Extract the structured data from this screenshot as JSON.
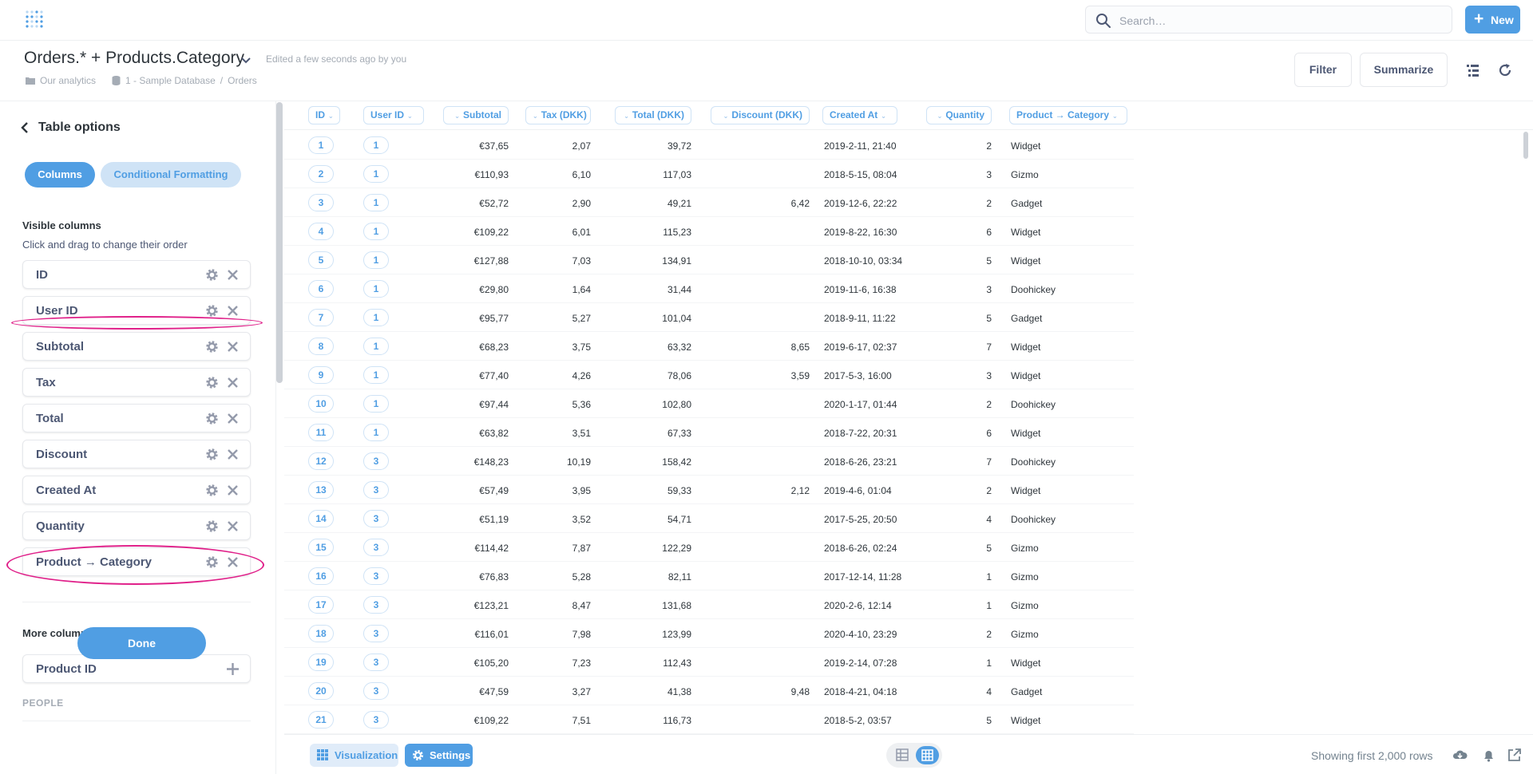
{
  "app": {
    "search_placeholder": "Search…",
    "new_label": "New",
    "accent": "#509ee3",
    "highlight": "#e0218a"
  },
  "question": {
    "title": "Orders.* + Products.Category",
    "edited": "Edited a few seconds ago by you",
    "breadcrumb": [
      "Our analytics",
      "1 - Sample Database",
      "Orders"
    ],
    "filter_label": "Filter",
    "summarize_label": "Summarize"
  },
  "sidebar": {
    "back_label": "Table options",
    "tabs": [
      "Columns",
      "Conditional Formatting"
    ],
    "visible_title": "Visible columns",
    "visible_hint": "Click and drag to change their order",
    "visible_columns": [
      "ID",
      "User ID",
      "Subtotal",
      "Tax",
      "Total",
      "Discount",
      "Created At",
      "Quantity",
      "Product → Category"
    ],
    "more_title": "More columns",
    "more_columns": [
      "Product ID"
    ],
    "group_label": "PEOPLE",
    "done_label": "Done"
  },
  "table": {
    "headers": [
      "ID",
      "User ID",
      "Subtotal",
      "Tax (DKK)",
      "Total (DKK)",
      "Discount (DKK)",
      "Created At",
      "Quantity",
      "Product → Category"
    ],
    "rows": [
      [
        "1",
        "1",
        "€37,65",
        "2,07",
        "39,72",
        "",
        "2019-2-11, 21:40",
        "2",
        "Widget"
      ],
      [
        "2",
        "1",
        "€110,93",
        "6,10",
        "117,03",
        "",
        "2018-5-15, 08:04",
        "3",
        "Gizmo"
      ],
      [
        "3",
        "1",
        "€52,72",
        "2,90",
        "49,21",
        "6,42",
        "2019-12-6, 22:22",
        "2",
        "Gadget"
      ],
      [
        "4",
        "1",
        "€109,22",
        "6,01",
        "115,23",
        "",
        "2019-8-22, 16:30",
        "6",
        "Widget"
      ],
      [
        "5",
        "1",
        "€127,88",
        "7,03",
        "134,91",
        "",
        "2018-10-10, 03:34",
        "5",
        "Widget"
      ],
      [
        "6",
        "1",
        "€29,80",
        "1,64",
        "31,44",
        "",
        "2019-11-6, 16:38",
        "3",
        "Doohickey"
      ],
      [
        "7",
        "1",
        "€95,77",
        "5,27",
        "101,04",
        "",
        "2018-9-11, 11:22",
        "5",
        "Gadget"
      ],
      [
        "8",
        "1",
        "€68,23",
        "3,75",
        "63,32",
        "8,65",
        "2019-6-17, 02:37",
        "7",
        "Widget"
      ],
      [
        "9",
        "1",
        "€77,40",
        "4,26",
        "78,06",
        "3,59",
        "2017-5-3, 16:00",
        "3",
        "Widget"
      ],
      [
        "10",
        "1",
        "€97,44",
        "5,36",
        "102,80",
        "",
        "2020-1-17, 01:44",
        "2",
        "Doohickey"
      ],
      [
        "11",
        "1",
        "€63,82",
        "3,51",
        "67,33",
        "",
        "2018-7-22, 20:31",
        "6",
        "Widget"
      ],
      [
        "12",
        "3",
        "€148,23",
        "10,19",
        "158,42",
        "",
        "2018-6-26, 23:21",
        "7",
        "Doohickey"
      ],
      [
        "13",
        "3",
        "€57,49",
        "3,95",
        "59,33",
        "2,12",
        "2019-4-6, 01:04",
        "2",
        "Widget"
      ],
      [
        "14",
        "3",
        "€51,19",
        "3,52",
        "54,71",
        "",
        "2017-5-25, 20:50",
        "4",
        "Doohickey"
      ],
      [
        "15",
        "3",
        "€114,42",
        "7,87",
        "122,29",
        "",
        "2018-6-26, 02:24",
        "5",
        "Gizmo"
      ],
      [
        "16",
        "3",
        "€76,83",
        "5,28",
        "82,11",
        "",
        "2017-12-14, 11:28",
        "1",
        "Gizmo"
      ],
      [
        "17",
        "3",
        "€123,21",
        "8,47",
        "131,68",
        "",
        "2020-2-6, 12:14",
        "1",
        "Gizmo"
      ],
      [
        "18",
        "3",
        "€116,01",
        "7,98",
        "123,99",
        "",
        "2020-4-10, 23:29",
        "2",
        "Gizmo"
      ],
      [
        "19",
        "3",
        "€105,20",
        "7,23",
        "112,43",
        "",
        "2019-2-14, 07:28",
        "1",
        "Widget"
      ],
      [
        "20",
        "3",
        "€47,59",
        "3,27",
        "41,38",
        "9,48",
        "2018-4-21, 04:18",
        "4",
        "Gadget"
      ],
      [
        "21",
        "3",
        "€109,22",
        "7,51",
        "116,73",
        "",
        "2018-5-2, 03:57",
        "5",
        "Widget"
      ]
    ]
  },
  "footer": {
    "visualization_label": "Visualization",
    "settings_label": "Settings",
    "showing_text": "Showing first 2,000 rows"
  }
}
